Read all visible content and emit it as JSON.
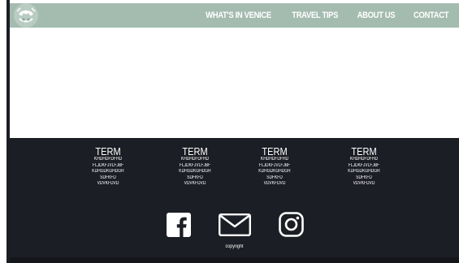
{
  "nav": {
    "items": [
      {
        "label": "WHAT'S IN VENICE"
      },
      {
        "label": "TRAVEL TIPS"
      },
      {
        "label": "ABOUT US"
      },
      {
        "label": "CONTACT"
      }
    ]
  },
  "footer": {
    "terms": [
      {
        "title": "TERM",
        "lines": [
          "KHDHDFDFHD",
          "FLJDKFJVLFJBF",
          "KDHGDKGHDGR",
          "SDFKFD",
          "VDVKFDVD"
        ]
      },
      {
        "title": "TERM",
        "lines": [
          "KHDHDFDFHD",
          "FLJDKFJVLFJBF",
          "KDHGDKGHDGR",
          "SDFKFD",
          "VDVKFDVD"
        ]
      },
      {
        "title": "TERM",
        "lines": [
          "KHDHDFDFHD",
          "FLJDKFJVLFJBF",
          "KDHGDKGHDGR",
          "SDFKFD",
          "VDVKFDVD"
        ]
      },
      {
        "title": "TERM",
        "lines": [
          "KHDHDFDFHD",
          "FLJDKFJVLFJBF",
          "KDHGDKGHDGR",
          "SDFKFD",
          "VDVKFDVD"
        ]
      }
    ],
    "social": {
      "icons": [
        "facebook-icon",
        "mail-icon",
        "instagram-icon"
      ]
    },
    "copyright": "copyright"
  },
  "colors": {
    "navbar": "#a4bbb0",
    "footer": "#1c1e25",
    "text": "#ffffff"
  }
}
